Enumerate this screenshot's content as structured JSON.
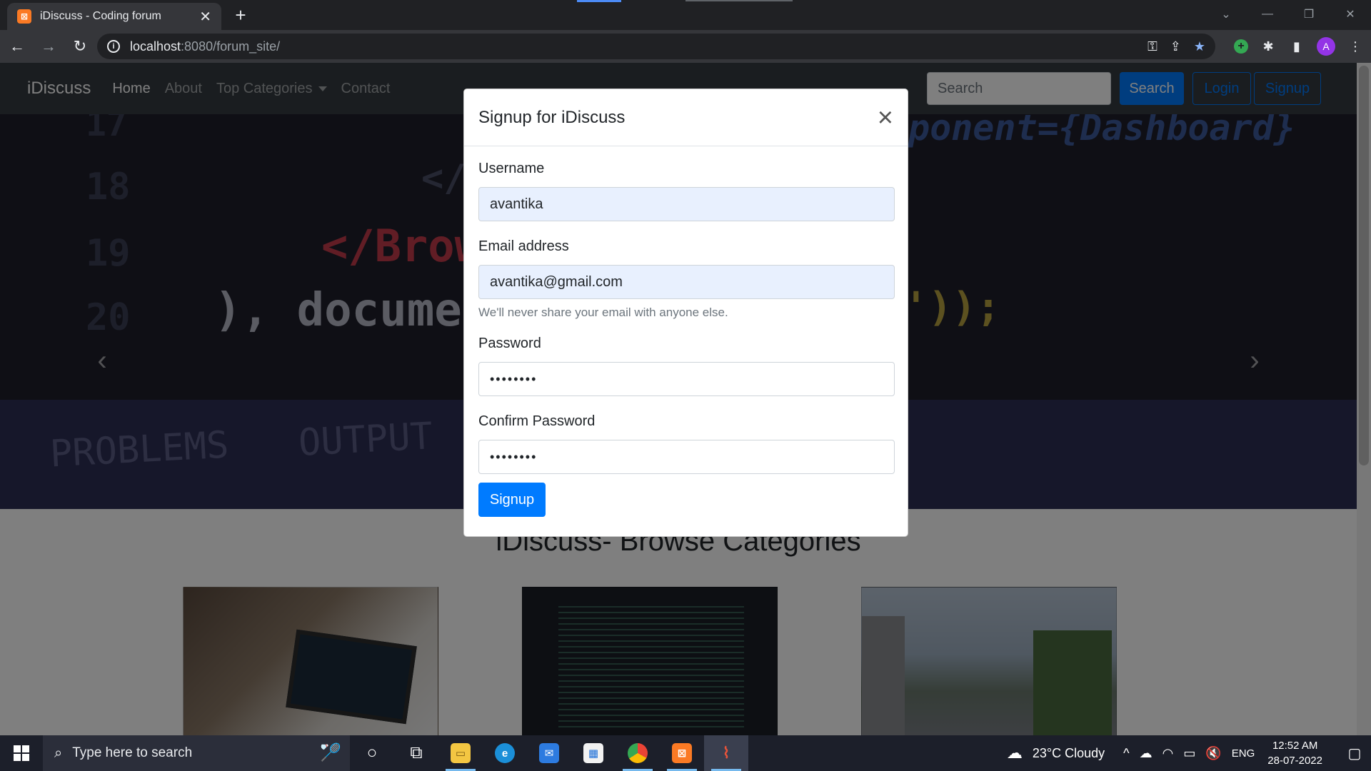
{
  "browser": {
    "tab_title": "iDiscuss - Coding forum",
    "tab_close": "✕",
    "new_tab": "+",
    "favicon_text": "⊠",
    "url_host": "localhost",
    "url_rest": ":8080/forum_site/",
    "profile_initial": "A"
  },
  "navbar": {
    "brand": "iDiscuss",
    "links": [
      "Home",
      "About",
      "Top Categories",
      "Contact"
    ],
    "search_placeholder": "Search",
    "search_button": "Search",
    "login_button": "Login",
    "signup_button": "Signup"
  },
  "hero": {
    "code_lines": [
      "17",
      "18",
      "</",
      "19",
      "</Brow",
      "20",
      "), documen",
      "ponent={Dashboard}",
      "'));"
    ],
    "panel_tabs": [
      "PROBLEMS",
      "OUTPUT"
    ]
  },
  "main": {
    "section_title": "iDiscuss- Browse Categories"
  },
  "modal": {
    "title": "Signup for iDiscuss",
    "close": "×",
    "username_label": "Username",
    "username_value": "avantika",
    "email_label": "Email address",
    "email_value": "avantika@gmail.com",
    "email_help": "We'll never share your email with anyone else.",
    "password_label": "Password",
    "password_value": "••••••••",
    "confirm_label": "Confirm Password",
    "confirm_value": "••••••••",
    "submit": "Signup"
  },
  "taskbar": {
    "search_placeholder": "Type here to search",
    "weather": "23°C  Cloudy",
    "language": "ENG",
    "time": "12:52 AM",
    "date": "28-07-2022"
  },
  "colors": {
    "primary": "#007bff",
    "navbar_bg": "#343a40",
    "autofill_bg": "#e8f0fe"
  }
}
